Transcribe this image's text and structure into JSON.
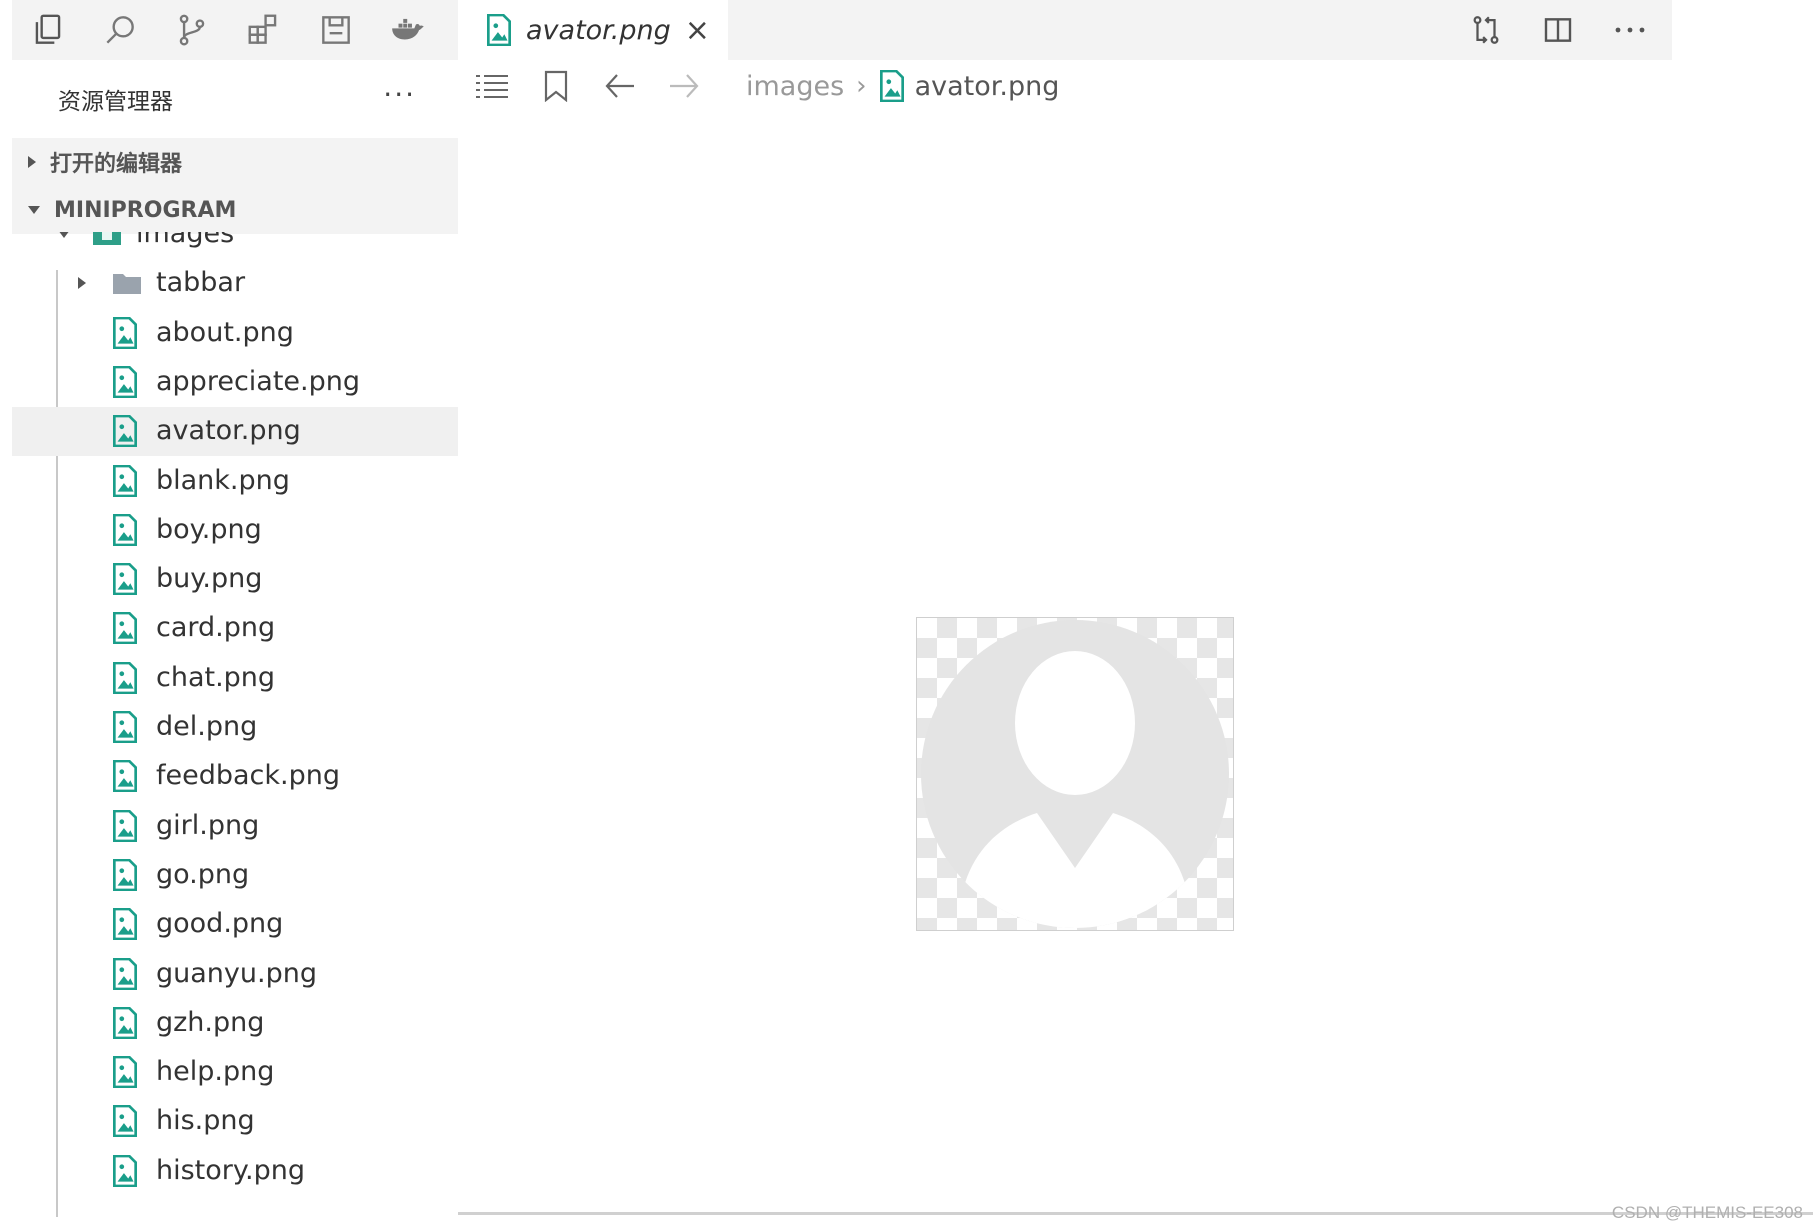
{
  "activity_bar": {
    "icons": [
      "files-icon",
      "search-icon",
      "source-control-icon",
      "extensions-icon",
      "save-icon",
      "docker-icon"
    ]
  },
  "explorer": {
    "title": "资源管理器",
    "more": "···",
    "open_editors_label": "打开的编辑器",
    "workspace_label": "MINIPROGRAM",
    "items": [
      {
        "label": "images",
        "type": "folder-open"
      },
      {
        "label": "tabbar",
        "type": "folder"
      },
      {
        "label": "about.png",
        "type": "file"
      },
      {
        "label": "appreciate.png",
        "type": "file"
      },
      {
        "label": "avator.png",
        "type": "file",
        "selected": true
      },
      {
        "label": "blank.png",
        "type": "file"
      },
      {
        "label": "boy.png",
        "type": "file"
      },
      {
        "label": "buy.png",
        "type": "file"
      },
      {
        "label": "card.png",
        "type": "file"
      },
      {
        "label": "chat.png",
        "type": "file"
      },
      {
        "label": "del.png",
        "type": "file"
      },
      {
        "label": "feedback.png",
        "type": "file"
      },
      {
        "label": "girl.png",
        "type": "file"
      },
      {
        "label": "go.png",
        "type": "file"
      },
      {
        "label": "good.png",
        "type": "file"
      },
      {
        "label": "guanyu.png",
        "type": "file"
      },
      {
        "label": "gzh.png",
        "type": "file"
      },
      {
        "label": "help.png",
        "type": "file"
      },
      {
        "label": "his.png",
        "type": "file"
      },
      {
        "label": "history.png",
        "type": "file"
      }
    ]
  },
  "editor": {
    "active_tab": "avator.png",
    "close_symbol": "×",
    "breadcrumb": {
      "folder": "images",
      "separator": "›",
      "file": "avator.png"
    },
    "actions": [
      "compare-icon",
      "split-editor-icon",
      "more-actions-icon"
    ]
  },
  "colors": {
    "accent": "#1a9e8a",
    "sidebar_bg": "#f3f3f3",
    "selected_row": "#f0f0f0"
  },
  "watermark": "CSDN @THEMIS-EE308"
}
